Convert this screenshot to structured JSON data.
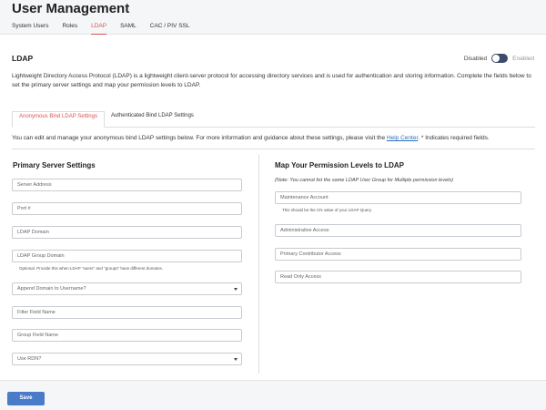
{
  "header": {
    "title": "User Management",
    "tabs": [
      {
        "label": "System Users"
      },
      {
        "label": "Roles"
      },
      {
        "label": "LDAP"
      },
      {
        "label": "SAML"
      },
      {
        "label": "CAC / PIV SSL"
      }
    ],
    "active_tab": "LDAP"
  },
  "section": {
    "title": "LDAP",
    "toggle": {
      "off_label": "Disabled",
      "on_label": "Enabled",
      "state": "disabled"
    },
    "description": "Lightweight Directory Access Protocol (LDAP) is a lightweight client-server protocol for accessing directory services and is used for authentication and storing information. Complete the fields below to set the primary server settings and map your permission levels to LDAP."
  },
  "sub_tabs": [
    {
      "label": "Anonymous Bind LDAP Settings",
      "active": true
    },
    {
      "label": "Authenticated Bind LDAP Settings",
      "active": false
    }
  ],
  "info": {
    "before": "You can edit and manage your anonymous bind LDAP settings below. For more information and guidance about these settings, please visit the ",
    "link": "Help Center",
    "after": ". * Indicates required fields."
  },
  "primary": {
    "title": "Primary Server Settings",
    "server_address": "Server Address",
    "port": "Port #",
    "ldap_domain": "LDAP Domain",
    "ldap_group_domain": "LDAP Group Domain",
    "group_domain_hint": "Optional. Provide this when LDAP \"users\" and \"groups\" have different domains.",
    "append_domain": "Append Domain to Username?",
    "filter_field": "Filter Field Name",
    "group_field": "Group Field Name",
    "use_rdn": "Use RDN?"
  },
  "permissions": {
    "title": "Map Your Permission Levels to LDAP",
    "note": "(Note: You cannot list the same LDAP User Group for Multiple permission levels)",
    "maintenance": "Maintenance Account",
    "maintenance_hint": "This should be the CN value of your LDAP Query.",
    "administrative": "Administrative Access",
    "primary_contributor": "Primary Contributor Access",
    "read_only": "Read Only Access"
  },
  "footer": {
    "save_label": "Save"
  },
  "colors": {
    "accent": "#d9534f",
    "toggle": "#3d4c6a",
    "button": "#4a7bc8",
    "link": "#2a6ebb"
  }
}
